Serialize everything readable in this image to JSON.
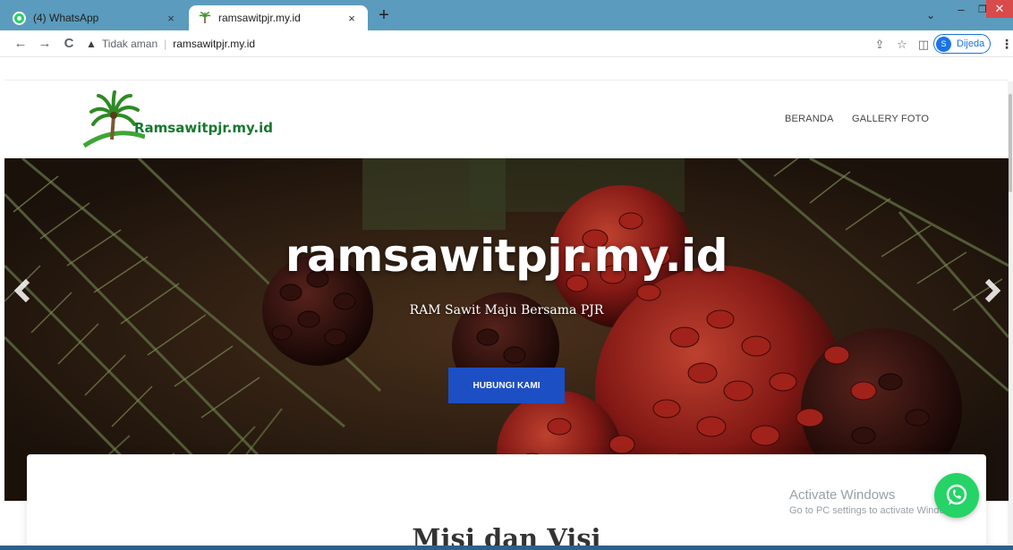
{
  "browser": {
    "tabs": [
      {
        "title": "(4) WhatsApp",
        "active": false,
        "icon": "whatsapp-icon"
      },
      {
        "title": "ramsawitpjr.my.id",
        "active": true,
        "icon": "palm-tree-icon"
      }
    ],
    "close_glyph": "×",
    "new_tab_glyph": "+",
    "window_controls": {
      "chevron": "⌄",
      "minimize": "–",
      "maximize": "❐",
      "close": "✕"
    },
    "nav": {
      "back": "←",
      "forward": "→",
      "reload": "C"
    },
    "address": {
      "warning_glyph": "▲",
      "security_label": "Tidak aman",
      "separator": "|",
      "url": "ramsawitpjr.my.id"
    },
    "toolbar_icons": {
      "share": "⇪",
      "bookmark": "☆",
      "sidepanel": "◫"
    },
    "profile": {
      "initial": "S",
      "name": "Dijeda"
    },
    "menu_glyph": "⋮"
  },
  "site": {
    "logo_text": "Ramsawitpjr.my.id",
    "nav": [
      "BERANDA",
      "GALLERY FOTO"
    ],
    "hero": {
      "title": "ramsawitpjr.my.id",
      "subtitle": "RAM Sawit Maju Bersama PJR",
      "cta": "HUBUNGI KAMI"
    },
    "section_heading": "Misi dan Visi"
  },
  "overlay": {
    "activate_title": "Activate Windows",
    "activate_sub": "Go to PC settings to activate Windows."
  },
  "colors": {
    "tabbar": "#5b9bbd",
    "cta": "#1d4fc4",
    "whatsapp": "#25d366",
    "logo_green": "#15792e"
  }
}
